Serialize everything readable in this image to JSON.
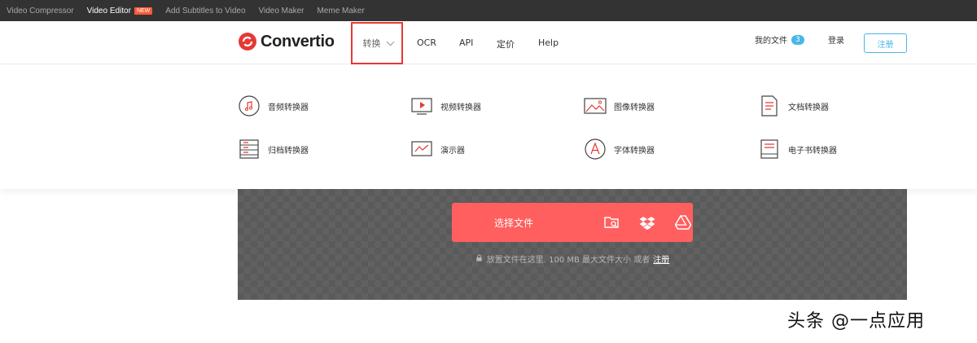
{
  "topbar": {
    "links": [
      {
        "label": "Video Compressor"
      },
      {
        "label": "Video Editor",
        "badge": "NEW"
      },
      {
        "label": "Add Subtitles to Video"
      },
      {
        "label": "Video Maker"
      },
      {
        "label": "Meme Maker"
      }
    ]
  },
  "header": {
    "logo_text": "Convertio",
    "nav": {
      "convert": "转换",
      "ocr": "OCR",
      "api": "API",
      "pricing": "定价",
      "help": "Help"
    },
    "my_files": "我的文件",
    "my_files_count": "3",
    "login": "登录",
    "signup": "注册"
  },
  "dropdown": {
    "items": [
      {
        "label": "音频转换器",
        "icon": "music-note-icon"
      },
      {
        "label": "视频转换器",
        "icon": "video-monitor-icon"
      },
      {
        "label": "图像转换器",
        "icon": "image-icon"
      },
      {
        "label": "文档转换器",
        "icon": "document-icon"
      },
      {
        "label": "归档转换器",
        "icon": "archive-icon"
      },
      {
        "label": "演示器",
        "icon": "presentation-icon"
      },
      {
        "label": "字体转换器",
        "icon": "font-icon"
      },
      {
        "label": "电子书转换器",
        "icon": "ebook-icon"
      }
    ]
  },
  "upload": {
    "choose_files": "选择文件",
    "drop_hint": "放置文件在这里. 100 MB 最大文件大小 或者",
    "drop_hint_link": "注册",
    "icons": [
      "folder-search-icon",
      "dropbox-icon",
      "google-drive-icon"
    ]
  },
  "watermark": "头条 @一点应用",
  "colors": {
    "accent_red": "#ff5f5f",
    "accent_blue": "#4ab6e8",
    "highlight_border": "#e53935",
    "topbar_bg": "#333333"
  }
}
